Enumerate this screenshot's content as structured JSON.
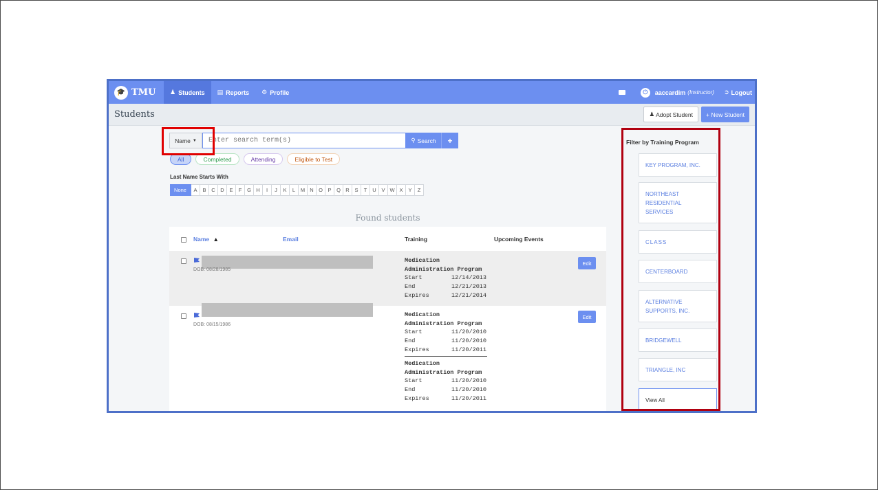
{
  "navbar": {
    "brand": "TMU",
    "tabs": [
      {
        "label": "Students",
        "icon": "user-icon"
      },
      {
        "label": "Reports",
        "icon": "bar-chart-icon"
      },
      {
        "label": "Profile",
        "icon": "gear-icon"
      }
    ],
    "user": {
      "name": "aaccardim",
      "role": "(Instructor)"
    },
    "logout": "Logout"
  },
  "subheader": {
    "title": "Students",
    "adopt_label": "Adopt Student",
    "new_label": "+ New Student"
  },
  "search": {
    "type_label": "Name",
    "placeholder": "Enter search term(s)",
    "button_label": "Search",
    "plus_label": "+"
  },
  "status_filters": [
    "All",
    "Completed",
    "Attending",
    "Eligible to Test"
  ],
  "letters": {
    "label": "Last Name Starts With",
    "none_label": "None",
    "items": [
      "A",
      "B",
      "C",
      "D",
      "E",
      "F",
      "G",
      "H",
      "I",
      "J",
      "K",
      "L",
      "M",
      "N",
      "O",
      "P",
      "Q",
      "R",
      "S",
      "T",
      "U",
      "V",
      "W",
      "X",
      "Y",
      "Z"
    ]
  },
  "found_title": "Found students",
  "table": {
    "columns": {
      "name": "Name",
      "email": "Email",
      "training": "Training",
      "events": "Upcoming Events"
    },
    "edit_label": "Edit",
    "rows": [
      {
        "dob": "DOB: 08/28/1985",
        "trainings": [
          {
            "title_1": "Medication",
            "title_2": "Administration Program",
            "start_label": "Start",
            "start": "12/14/2013",
            "end_label": "End",
            "end": "12/21/2013",
            "expires_label": "Expires",
            "expires": "12/21/2014"
          }
        ]
      },
      {
        "dob": "DOB: 08/15/1986",
        "trainings": [
          {
            "title_1": "Medication",
            "title_2": "Administration Program",
            "start_label": "Start",
            "start": "11/20/2010",
            "end_label": "End",
            "end": "11/20/2010",
            "expires_label": "Expires",
            "expires": "11/20/2011"
          },
          {
            "title_1": "Medication",
            "title_2": "Administration Program",
            "start_label": "Start",
            "start": "11/20/2010",
            "end_label": "End",
            "end": "11/20/2010",
            "expires_label": "Expires",
            "expires": "11/20/2011"
          }
        ]
      }
    ]
  },
  "sidebar": {
    "title": "Filter by Training Program",
    "programs": [
      {
        "line1": "KEY PROGRAM, INC."
      },
      {
        "line1": "NORTHEAST",
        "line2": "RESIDENTIAL",
        "line3": "SERVICES"
      },
      {
        "line1": "CLASS"
      },
      {
        "line1": "CENTERBOARD"
      },
      {
        "line1": "ALTERNATIVE",
        "line2": "SUPPORTS, INC."
      },
      {
        "line1": "BRIDGEWELL"
      },
      {
        "line1": "TRIANGLE, INC"
      }
    ],
    "view_all": "View All"
  },
  "colors": {
    "primary": "#6c8ff0",
    "callout_red": "#e00000",
    "callout_dark_red": "#b00010"
  }
}
